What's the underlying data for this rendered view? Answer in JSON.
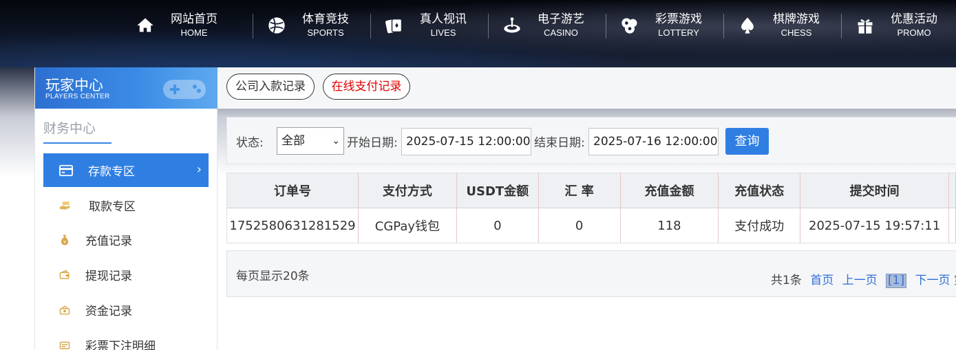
{
  "nav": [
    {
      "cn": "网站首页",
      "en": "HOME",
      "icon": "home-icon"
    },
    {
      "cn": "体育竞技",
      "en": "SPORTS",
      "icon": "ball-icon"
    },
    {
      "cn": "真人视讯",
      "en": "LIVES",
      "icon": "cards-icon"
    },
    {
      "cn": "电子游艺",
      "en": "CASINO",
      "icon": "roulette-icon"
    },
    {
      "cn": "彩票游戏",
      "en": "LOTTERY",
      "icon": "lottery-balls-icon"
    },
    {
      "cn": "棋牌游戏",
      "en": "CHESS",
      "icon": "spade-icon"
    },
    {
      "cn": "优惠活动",
      "en": "PROMO",
      "icon": "gift-icon"
    }
  ],
  "sidebar": {
    "banner_cn": "玩家中心",
    "banner_en": "PLAYERS CENTER",
    "section": "财务中心",
    "items": [
      {
        "label": "存款专区",
        "icon": "deposit-card-icon",
        "active": true
      },
      {
        "label": "取款专区",
        "icon": "cash-hand-icon"
      },
      {
        "label": "充值记录",
        "icon": "money-bag-icon"
      },
      {
        "label": "提现记录",
        "icon": "wallet-icon"
      },
      {
        "label": "资金记录",
        "icon": "funds-icon"
      },
      {
        "label": "彩票下注明细",
        "icon": "ticket-icon"
      }
    ]
  },
  "tabs": {
    "company": "公司入款记录",
    "online": "在线支付记录"
  },
  "filter": {
    "status_label": "状态:",
    "status_value": "全部",
    "start_label": "开始日期:",
    "start_value": "2025-07-15 12:00:00",
    "end_label": "结束日期:",
    "end_value": "2025-07-16 12:00:00",
    "query_button": "查询"
  },
  "table": {
    "headers": [
      "订单号",
      "支付方式",
      "USDT金额",
      "汇 率",
      "充值金额",
      "充值状态",
      "提交时间"
    ],
    "rows": [
      [
        "1752580631281529",
        "CGPay钱包",
        "0",
        "0",
        "118",
        "支付成功",
        "2025-07-15 19:57:11"
      ]
    ]
  },
  "pagination": {
    "per_page": "每页显示20条",
    "total": "共1条",
    "first": "首页",
    "prev": "上一页",
    "current": "[1]",
    "next": "下一页",
    "trailing": "第"
  },
  "colors": {
    "accent": "#2f7fe3",
    "tab_red": "#e00000"
  }
}
